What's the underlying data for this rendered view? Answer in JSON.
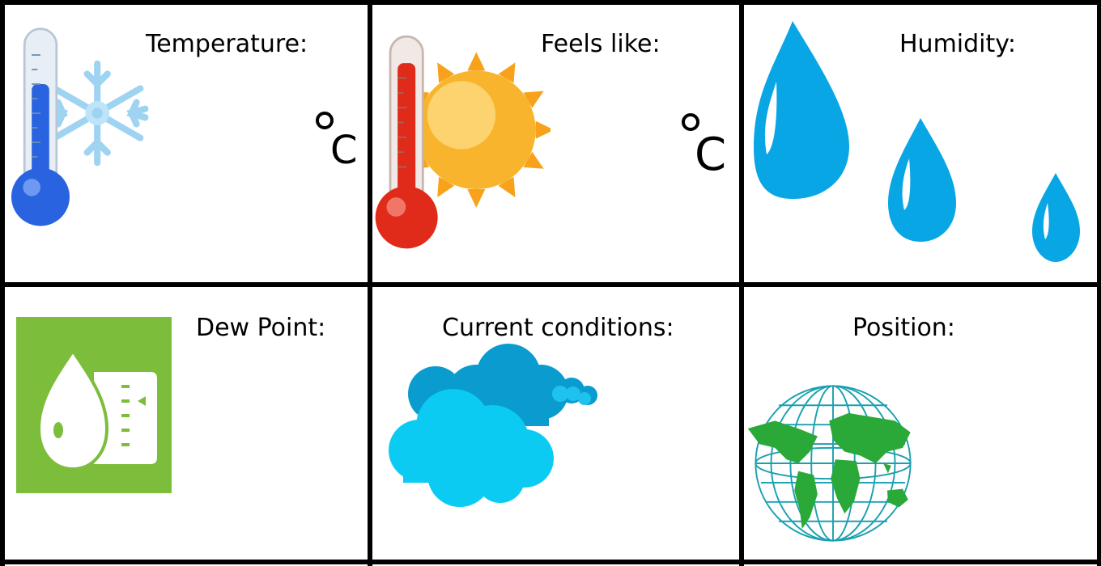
{
  "tiles": {
    "temperature": {
      "label": "Temperature:",
      "unit": "C",
      "icon": "cold-thermometer-icon"
    },
    "feels_like": {
      "label": "Feels like:",
      "unit": "C",
      "icon": "hot-thermometer-sun-icon"
    },
    "humidity": {
      "label": "Humidity:",
      "icon": "water-drops-icon"
    },
    "dew_point": {
      "label": "Dew Point:",
      "icon": "dew-point-icon"
    },
    "current_conditions": {
      "label": "Current conditions:",
      "icon": "clouds-icon"
    },
    "position": {
      "label": "Position:",
      "icon": "globe-icon"
    }
  },
  "colors": {
    "grid": "#000000",
    "cold_blue": "#2a63e0",
    "hot_red": "#e02a1a",
    "sun_orange": "#f7a21a",
    "drop_blue": "#08a6e4",
    "dew_green": "#7dbd3c",
    "cloud_light": "#0ccbf2",
    "cloud_dark": "#0a9ccf",
    "globe_line": "#1aa0b0",
    "land_green": "#2aa838"
  }
}
